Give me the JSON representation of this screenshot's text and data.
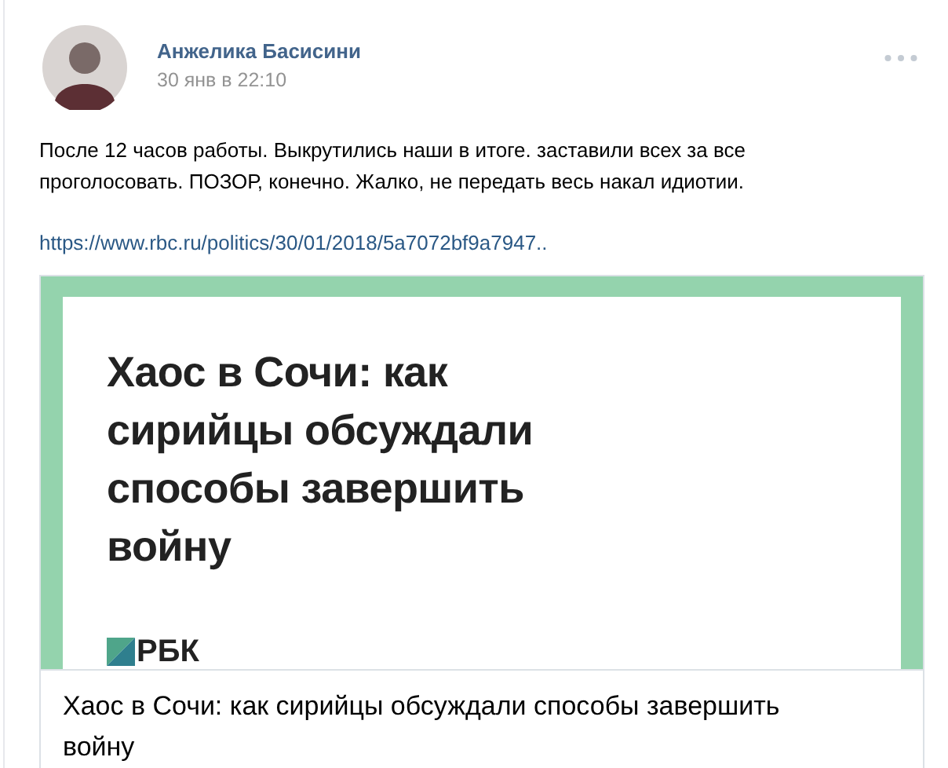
{
  "post": {
    "author": "Анжелика Басисини",
    "date": "30 янв в 22:10",
    "text": "После 12 часов работы. Выкрутились наши в итоге. заставили всех за все проголосовать. ПОЗОР, конечно. Жалко, не передать весь накал идиотии.",
    "link": "https://www.rbc.ru/politics/30/01/2018/5a7072bf9a7947..",
    "attachment": {
      "image_headline": "Хаос в Сочи: как сирийцы обсуждали способы завершить войну",
      "image_logo": "РБК",
      "title": "Хаос в Сочи: как сирийцы обсуждали способы завершить войну"
    }
  }
}
